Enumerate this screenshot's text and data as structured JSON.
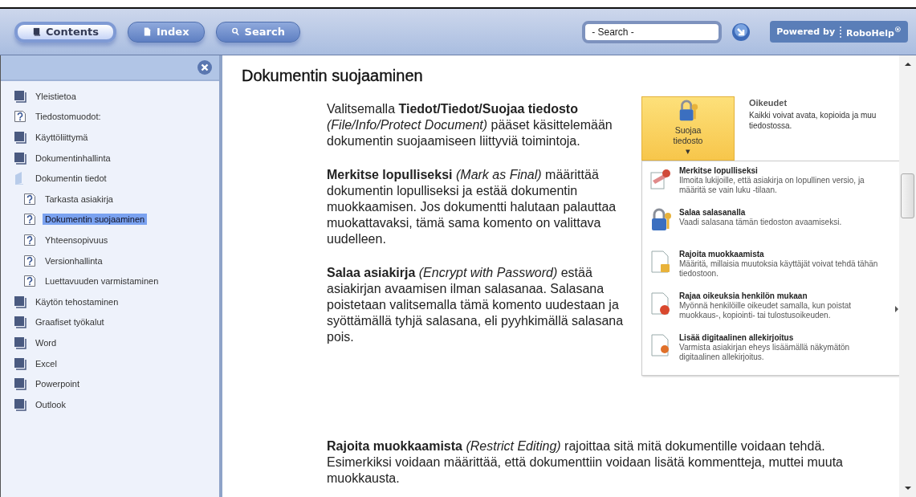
{
  "toolbar": {
    "tabs": [
      {
        "label": "Contents",
        "kind": "book",
        "selected": true
      },
      {
        "label": "Index",
        "kind": "page",
        "selected": false
      },
      {
        "label": "Search",
        "kind": "magnifier",
        "selected": false
      }
    ],
    "search": {
      "placeholder": "- Search -"
    },
    "powered_by": {
      "label": "Powered by",
      "brand": "RoboHelp$^{®}$"
    }
  },
  "toc": [
    {
      "label": "Yleistietoa",
      "kind": "book",
      "selected": false
    },
    {
      "label": "Tiedostomuodot:",
      "kind": "page",
      "selected": false
    },
    {
      "label": "Käyttöliittymä",
      "kind": "book",
      "selected": false
    },
    {
      "label": "Dokumentinhallinta",
      "kind": "book",
      "selected": false
    },
    {
      "label": "Dokumentin tiedot",
      "kind": "book-open",
      "selected": false,
      "children": [
        {
          "label": "Tarkasta asiakirja",
          "kind": "page",
          "selected": false
        },
        {
          "label": "Dokumentin suojaaminen",
          "kind": "page",
          "selected": true
        },
        {
          "label": "Yhteensopivuus",
          "kind": "page",
          "selected": false
        },
        {
          "label": "Versionhallinta",
          "kind": "page",
          "selected": false
        },
        {
          "label": "Luettavuuden varmistaminen",
          "kind": "page",
          "selected": false
        }
      ]
    },
    {
      "label": "Käytön tehostaminen",
      "kind": "book",
      "selected": false
    },
    {
      "label": "Graafiset työkalut",
      "kind": "book",
      "selected": false
    },
    {
      "label": "Word",
      "kind": "book",
      "selected": false
    },
    {
      "label": "Excel",
      "kind": "book",
      "selected": false
    },
    {
      "label": "Powerpoint",
      "kind": "book",
      "selected": false
    },
    {
      "label": "Outlook",
      "kind": "book",
      "selected": false
    }
  ],
  "article": {
    "title": "Dokumentin suojaaminen",
    "paragraphs": [
      "Valitsemalla **Tiedot/Tiedot/Suojaa tiedosto** *(File/Info/Protect Document)* pääset käsittelemään dokumentin suojaamiseen liittyviä toimintoja.",
      "**Merkitse lopulliseksi** *(Mark as Final)* määrittää dokumentin lopulliseksi ja estää dokumentin muokkaamisen. Jos dokumentti halutaan palauttaa muokattavaksi, tämä sama komento on valittava uudelleen.",
      "**Salaa asiakirja** *(Encrypt with Password)* estää asiakirjan avaamisen ilman salasanaa. Salasana poistetaan valitsemalla tämä komento uudestaan ja syöttämällä tyhjä salasana, eli pyyhkimällä salasana pois."
    ],
    "bottom_paragraph": "**Rajoita muokkaamista** *(Restrict Editing)* rajoittaa sitä mitä dokumentille voidaan tehdä. Esimerkiksi voidaan määrittää, että dokumenttiin voidaan lisätä kommentteja, muttei muuta muokkausta.",
    "screenshot": {
      "button": "Suojaa tiedosto ▾",
      "heading": "Oikeudet",
      "description": "Kaikki voivat avata, kopioida ja muu tiedostossa.",
      "menu": [
        {
          "title": "Merkitse lopulliseksi",
          "text": "Ilmoita lukijoille, että asiakirja on lopullinen versio, ja määritä se vain luku -tilaan.",
          "kind": "stamp",
          "submenu": false
        },
        {
          "title": "Salaa salasanalla",
          "text": "Vaadi salasana tämän tiedoston avaamiseksi.",
          "kind": "lock",
          "submenu": false
        },
        {
          "title": "Rajoita muokkaamista",
          "text": "Määritä, millaisia muutoksia käyttäjät voivat tehdä tähän tiedostoon.",
          "kind": "doc-lock",
          "submenu": false
        },
        {
          "title": "Rajaa oikeuksia henkilön mukaan",
          "text": "Myönnä henkilöille oikeudet samalla, kun poistat muokkaus-, kopiointi- tai tulostusoikeuden.",
          "kind": "doc-stop",
          "submenu": true
        },
        {
          "title": "Lisää digitaalinen allekirjoitus",
          "text": "Varmista asiakirjan eheys lisäämällä näkymätön digitaalinen allekirjoitus.",
          "kind": "doc-ribbon",
          "submenu": false
        }
      ]
    }
  }
}
